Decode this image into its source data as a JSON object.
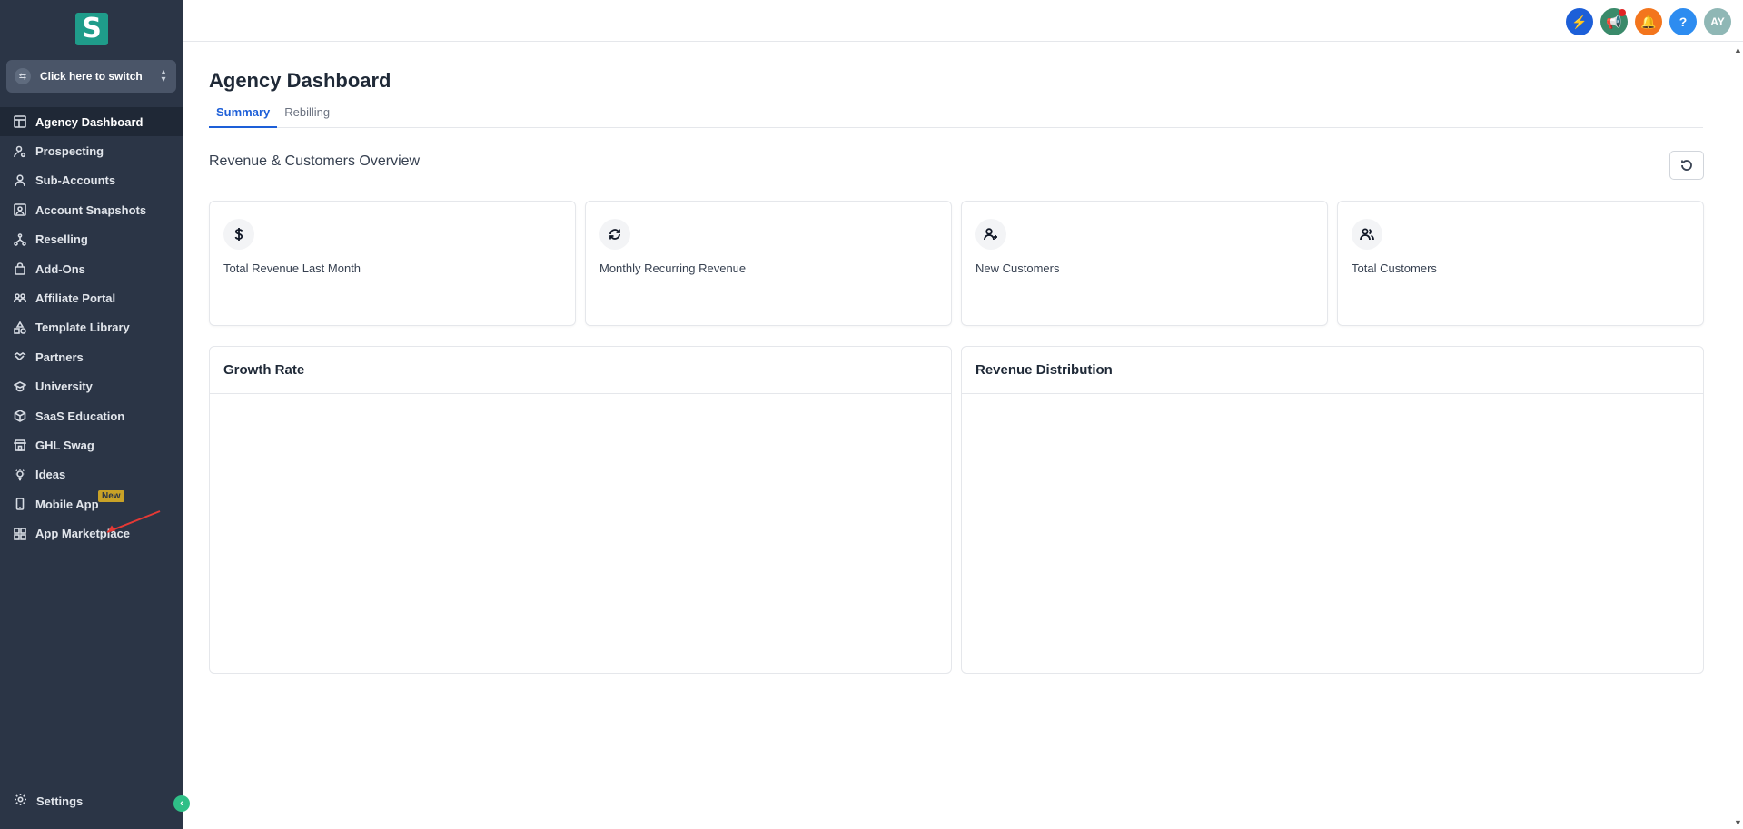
{
  "sidebar": {
    "logo_letter": "S",
    "switcher_label": "Click here to switch",
    "items": [
      {
        "label": "Agency Dashboard",
        "icon": "dashboard-icon",
        "active": true
      },
      {
        "label": "Prospecting",
        "icon": "user-search-icon"
      },
      {
        "label": "Sub-Accounts",
        "icon": "user-icon"
      },
      {
        "label": "Account Snapshots",
        "icon": "snapshot-icon"
      },
      {
        "label": "Reselling",
        "icon": "branch-icon"
      },
      {
        "label": "Add-Ons",
        "icon": "bag-icon"
      },
      {
        "label": "Affiliate Portal",
        "icon": "users-icon"
      },
      {
        "label": "Template Library",
        "icon": "shapes-icon"
      },
      {
        "label": "Partners",
        "icon": "handshake-icon"
      },
      {
        "label": "University",
        "icon": "graduation-cap-icon"
      },
      {
        "label": "SaaS Education",
        "icon": "cube-icon"
      },
      {
        "label": "GHL Swag",
        "icon": "store-icon"
      },
      {
        "label": "Ideas",
        "icon": "lightbulb-icon"
      },
      {
        "label": "Mobile App",
        "icon": "phone-icon",
        "badge": "New"
      },
      {
        "label": "App Marketplace",
        "icon": "grid-icon"
      }
    ],
    "settings_label": "Settings"
  },
  "topbar": {
    "avatar_initials": "AY",
    "help_label": "?"
  },
  "main": {
    "title": "Agency Dashboard",
    "tabs": [
      {
        "label": "Summary",
        "active": true
      },
      {
        "label": "Rebilling"
      }
    ],
    "section_title": "Revenue & Customers Overview",
    "cards": [
      {
        "label": "Total Revenue Last Month",
        "icon": "dollar-icon"
      },
      {
        "label": "Monthly Recurring Revenue",
        "icon": "refresh-cycle-icon"
      },
      {
        "label": "New Customers",
        "icon": "user-plus-icon"
      },
      {
        "label": "Total Customers",
        "icon": "users-icon"
      }
    ],
    "panels": [
      {
        "title": "Growth Rate"
      },
      {
        "title": "Revenue Distribution"
      }
    ]
  },
  "colors": {
    "sidebar_bg": "#2b3546",
    "accent": "#1d5fd8",
    "brand": "#1f9c8a"
  }
}
